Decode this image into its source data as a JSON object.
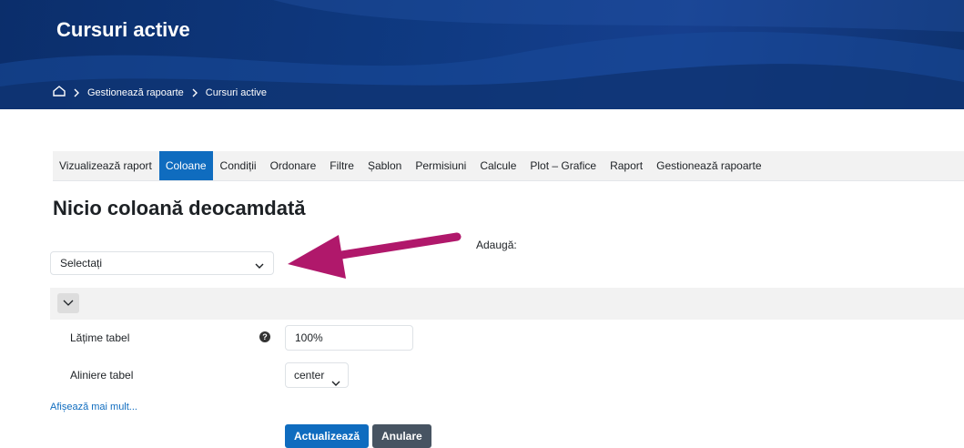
{
  "header": {
    "title": "Cursuri active"
  },
  "breadcrumb": {
    "items": [
      "Gestionează rapoarte",
      "Cursuri active"
    ]
  },
  "tabs": [
    {
      "label": "Vizualizează raport"
    },
    {
      "label": "Coloane",
      "active": true
    },
    {
      "label": "Condiții"
    },
    {
      "label": "Ordonare"
    },
    {
      "label": "Filtre"
    },
    {
      "label": "Șablon"
    },
    {
      "label": "Permisiuni"
    },
    {
      "label": "Calcule"
    },
    {
      "label": "Plot – Grafice"
    },
    {
      "label": "Raport"
    },
    {
      "label": "Gestionează rapoarte"
    }
  ],
  "main": {
    "heading": "Nicio coloană deocamdată",
    "column_select": {
      "value": "Selectați"
    },
    "add_label": "Adaugă:",
    "form": {
      "width_label": "Lățime tabel",
      "width_value": "100%",
      "align_label": "Aliniere tabel",
      "align_value": "center",
      "more_link": "Afișează mai mult...",
      "submit": "Actualizează",
      "cancel": "Anulare"
    }
  },
  "colors": {
    "accent": "#0f6cbf",
    "banner": "#0f3a82",
    "annotation_arrow": "#b0186b",
    "secondary_button": "#475462"
  }
}
